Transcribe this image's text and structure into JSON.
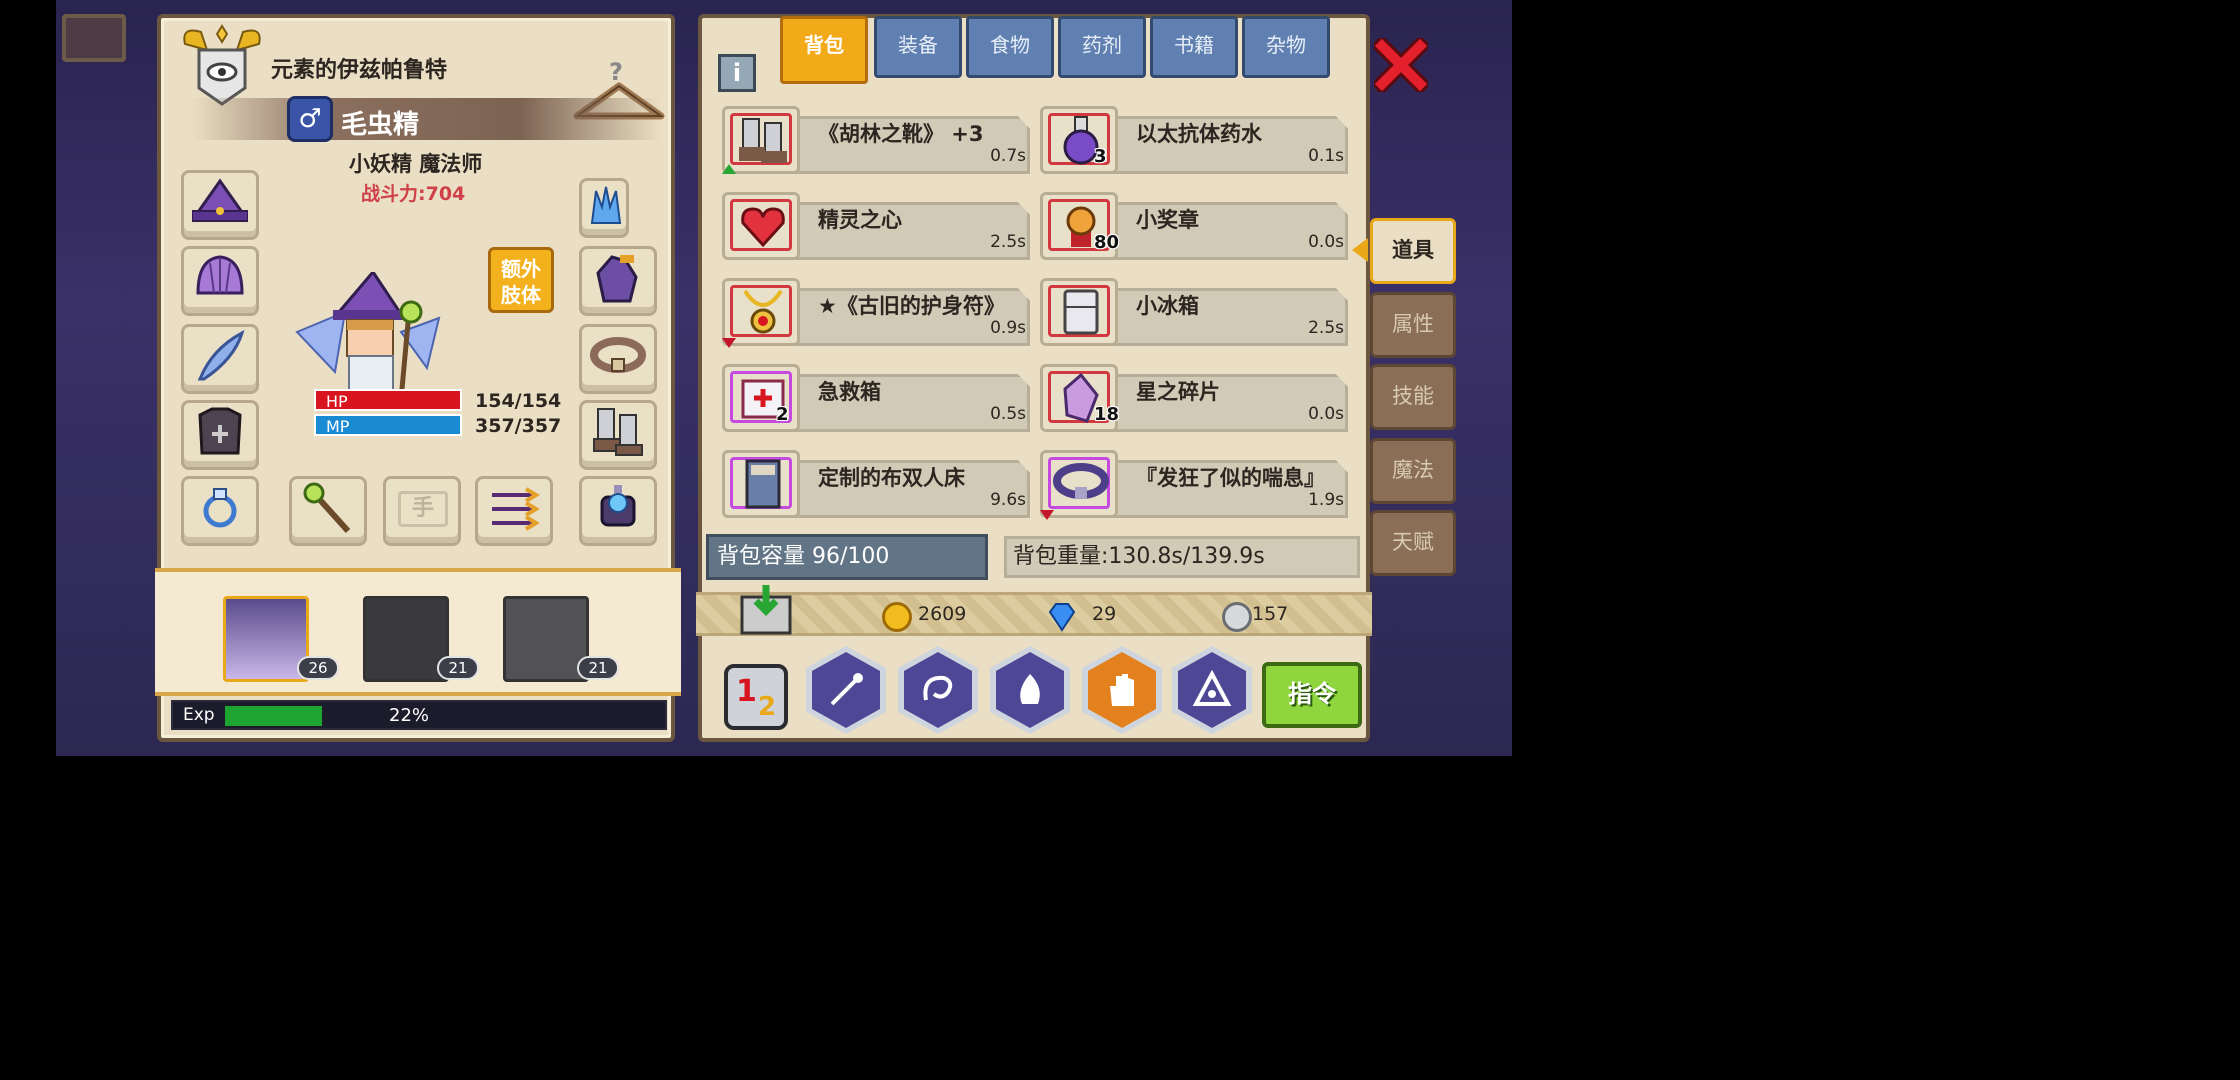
{
  "character": {
    "title": "元素的伊兹帕鲁特",
    "gender_symbol": "♂",
    "job": "毛虫精",
    "race_class": "小妖精 魔法师",
    "power": "战斗力:704",
    "extra_limb_label": "额外\n肢体",
    "hand_slot_label": "手",
    "hp_label": "HP",
    "mp_label": "MP",
    "hp": "154/154",
    "mp": "357/357"
  },
  "party": [
    {
      "level": "26"
    },
    {
      "level": "21"
    },
    {
      "level": "21"
    }
  ],
  "exp": {
    "label": "Exp",
    "percent_text": "22%",
    "fill_fraction": 0.22
  },
  "inventory": {
    "tabs": [
      "背包",
      "装备",
      "食物",
      "药剂",
      "书籍",
      "杂物"
    ],
    "active_tab": 0,
    "info_label": "i",
    "items": [
      {
        "name": "《胡林之靴》 +3",
        "weight": "0.7s",
        "qty": "",
        "flag": "up"
      },
      {
        "name": "以太抗体药水",
        "weight": "0.1s",
        "qty": "3",
        "flag": ""
      },
      {
        "name": "精灵之心",
        "weight": "2.5s",
        "qty": "",
        "flag": ""
      },
      {
        "name": "小奖章",
        "weight": "0.0s",
        "qty": "80",
        "flag": ""
      },
      {
        "name": "★《古旧的护身符》",
        "weight": "0.9s",
        "qty": "",
        "flag": "down"
      },
      {
        "name": "小冰箱",
        "weight": "2.5s",
        "qty": "",
        "flag": ""
      },
      {
        "name": "急救箱",
        "weight": "0.5s",
        "qty": "2",
        "flag": ""
      },
      {
        "name": "星之碎片",
        "weight": "0.0s",
        "qty": "18",
        "flag": ""
      },
      {
        "name": "定制的布双人床",
        "weight": "9.6s",
        "qty": "",
        "flag": ""
      },
      {
        "name": "『发狂了似的喘息』",
        "weight": "1.9s",
        "qty": "",
        "flag": "down"
      }
    ],
    "capacity": "背包容量 96/100",
    "weight": "背包重量:130.8s/139.9s"
  },
  "currency": {
    "gold": "2609",
    "gems": "29",
    "silver": "157"
  },
  "command_label": "指令",
  "page_indicator": {
    "current": "1",
    "total": "2"
  },
  "side_tabs": [
    "道具",
    "属性",
    "技能",
    "魔法",
    "天赋"
  ],
  "active_side_tab": 0,
  "colors": {
    "hp": "#d8141e",
    "mp": "#1a8ad2",
    "accent": "#f2aa18",
    "power": "#d04048"
  }
}
